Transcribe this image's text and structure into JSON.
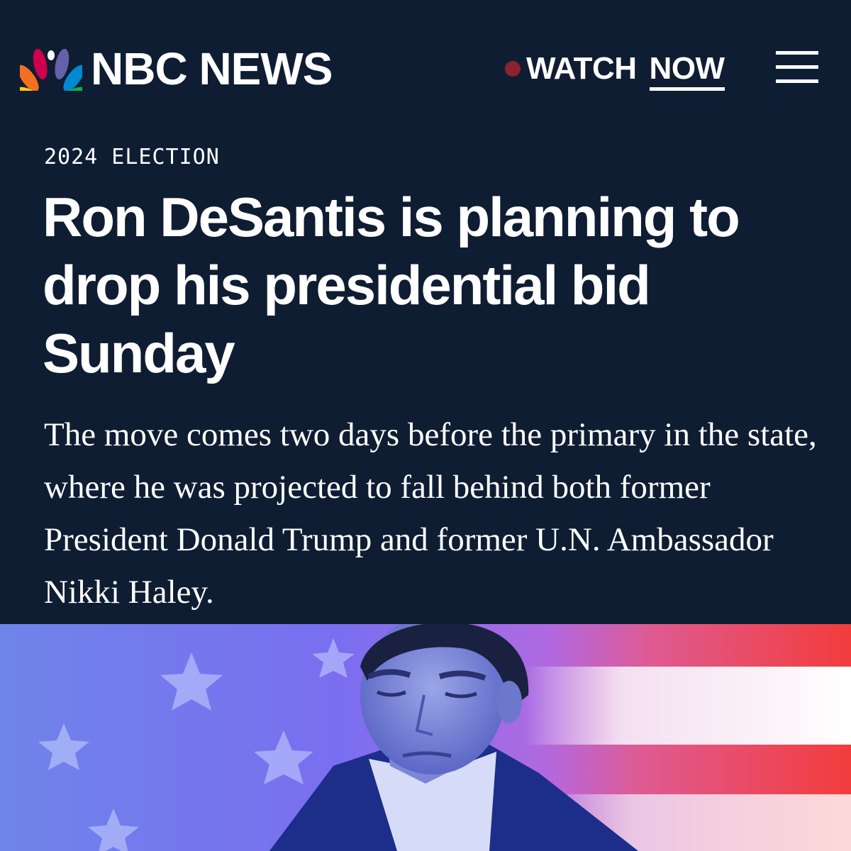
{
  "header": {
    "brand": "NBC NEWS",
    "watch_label": "WATCH",
    "now_label": "NOW",
    "icons": {
      "logo": "nbc-peacock-icon",
      "live": "live-dot-icon",
      "menu": "hamburger-menu-icon"
    }
  },
  "article": {
    "category": "2024 ELECTION",
    "headline": "Ron DeSantis is planning to drop his presidential bid Sunday",
    "dek": "The move comes two days before the primary in the state, where he was projected to fall behind both former President Donald Trump and former U.N. Ambassador Nikki Haley."
  },
  "colors": {
    "background": "#0f1d33",
    "text": "#ffffff",
    "live_dot": "#8b2230",
    "peacock": [
      "#fccc12",
      "#f37021",
      "#cc004c",
      "#6460aa",
      "#0089d0",
      "#0db14b"
    ]
  }
}
